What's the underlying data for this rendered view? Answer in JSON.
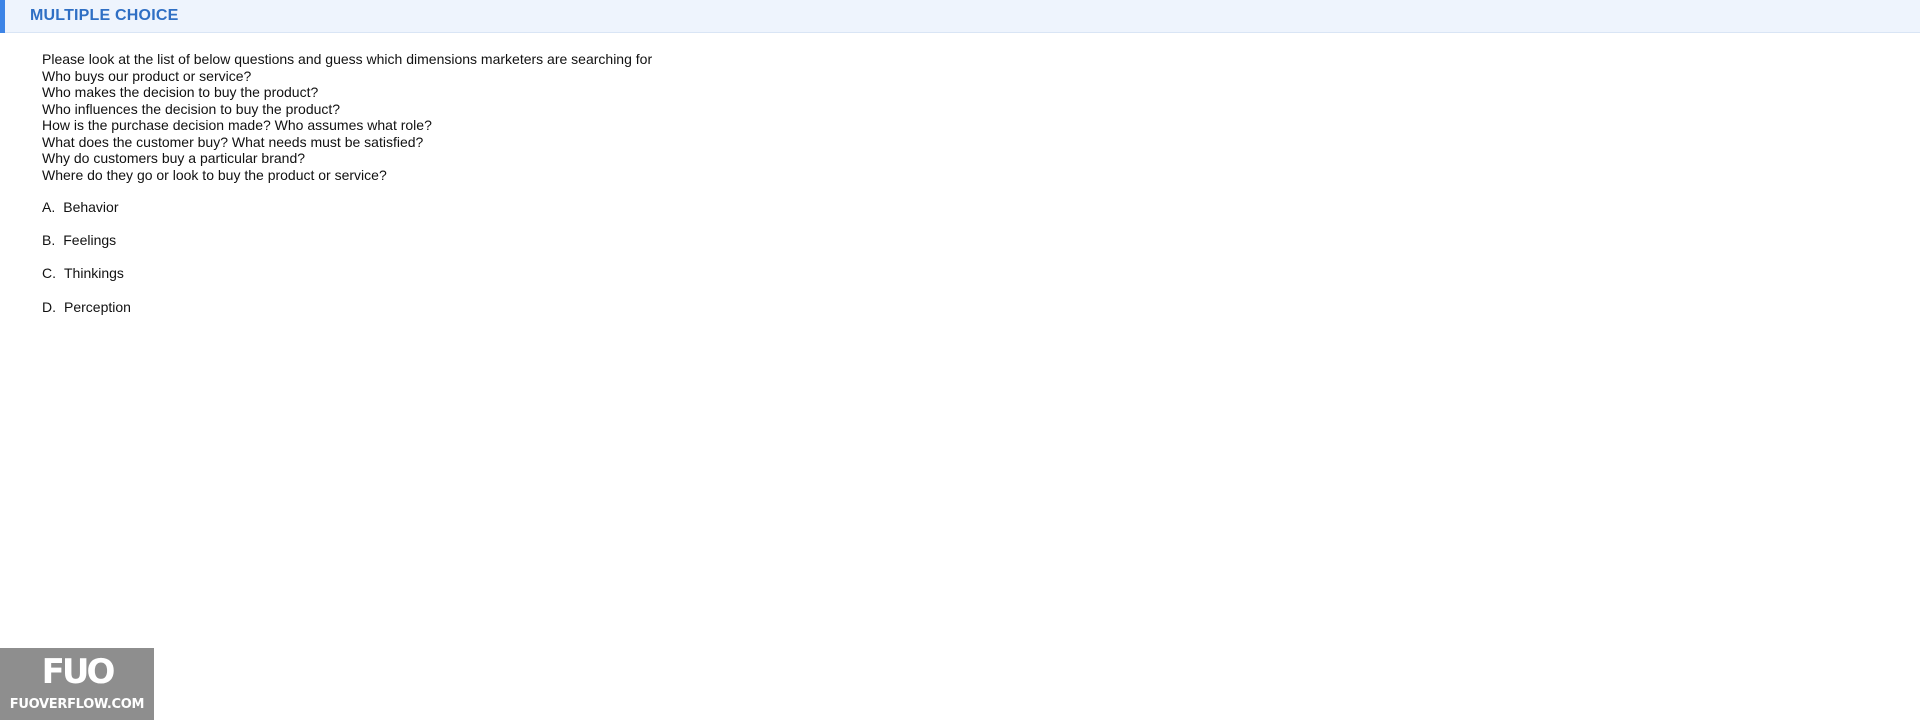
{
  "header": {
    "title": "MULTIPLE CHOICE",
    "accent_color": "#3d84e6",
    "title_color": "#2f6fc4",
    "background_color": "#eef4fd"
  },
  "question": {
    "lines": [
      "Please look at the list of below questions and guess which dimensions marketers are searching for",
      "Who buys our product or service?",
      "Who makes the decision to buy the product?",
      "Who influences the decision to buy the product?",
      "How is the purchase decision made? Who assumes what role?",
      "What does the customer buy? What needs must be satisfied?",
      "Why do customers buy a particular brand?",
      "Where do they go or look to buy the product or service?"
    ]
  },
  "options": [
    {
      "letter": "A.",
      "text": "Behavior"
    },
    {
      "letter": "B.",
      "text": "Feelings"
    },
    {
      "letter": "C.",
      "text": "Thinkings"
    },
    {
      "letter": "D.",
      "text": "Perception"
    }
  ],
  "watermark": {
    "logo": "FUO",
    "site": "FUOVERFLOW.COM"
  }
}
